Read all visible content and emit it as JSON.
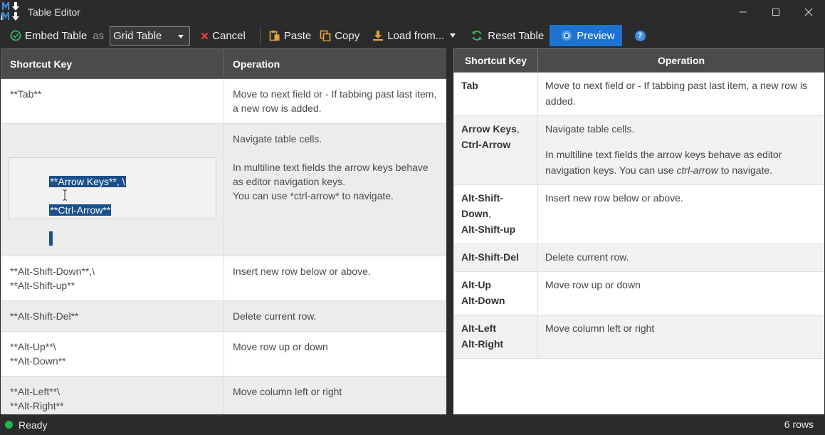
{
  "window": {
    "title": "Table Editor",
    "controls": [
      "—",
      "☐",
      "✕"
    ]
  },
  "toolbar": {
    "embed_label": "Embed Table",
    "as_label": "as",
    "table_type": "Grid Table",
    "cancel_label": "Cancel",
    "paste_label": "Paste",
    "copy_label": "Copy",
    "load_label": "Load from...",
    "reset_label": "Reset Table",
    "preview_label": "Preview",
    "help_label": "?"
  },
  "editor": {
    "headers": [
      "Shortcut Key",
      "Operation"
    ],
    "rows": [
      {
        "key": "**Tab**",
        "op": "Move to next field or - If tabbing past last item, a new row is added."
      },
      {
        "key_line1": "**Arrow Keys**, \\",
        "key_line2": "**Ctrl-Arrow**",
        "op": "Navigate table cells.\n\nIn multiline text fields the arrow keys behave as editor navigation keys.\nYou can use *ctrl-arrow* to navigate."
      },
      {
        "key": "**Alt-Shift-Down**,\\\n**Alt-Shift-up**",
        "op": "Insert new row below or above."
      },
      {
        "key": "**Alt-Shift-Del**",
        "op": "Delete current row."
      },
      {
        "key": "**Alt-Up**\\\n**Alt-Down**",
        "op": "Move row up or down"
      },
      {
        "key": "**Alt-Left**\\\n**Alt-Right**",
        "op": "Move column left or right"
      }
    ]
  },
  "preview": {
    "headers": [
      "Shortcut Key",
      "Operation"
    ],
    "rows": [
      {
        "key": "Tab",
        "op": "Move to next field or - If tabbing past last item, a new row is added."
      },
      {
        "key_a": "Arrow Keys",
        "key_b": "Ctrl-Arrow",
        "op_p1": "Navigate table cells.",
        "op_p2_a": "In multiline text fields the arrow keys behave as editor navigation keys. You can use ",
        "op_p2_em": "ctrl-arrow",
        "op_p2_b": " to navigate."
      },
      {
        "key_a": "Alt-Shift-Down",
        "key_b": "Alt-Shift-up",
        "op": "Insert new row below or above."
      },
      {
        "key": "Alt-Shift-Del",
        "op": "Delete current row."
      },
      {
        "key_a": "Alt-Up",
        "key_b": "Alt-Down",
        "op": "Move row up or down"
      },
      {
        "key_a": "Alt-Left",
        "key_b": "Alt-Right",
        "op": "Move column left or right"
      }
    ]
  },
  "status": {
    "text": "Ready",
    "row_count": "6 rows"
  },
  "colors": {
    "accent": "#1e73d0",
    "header_bg": "#4b4b4b",
    "chrome_bg": "#2b2b2b",
    "status_ok": "#1fb84c",
    "selection": "#1a4f89"
  }
}
